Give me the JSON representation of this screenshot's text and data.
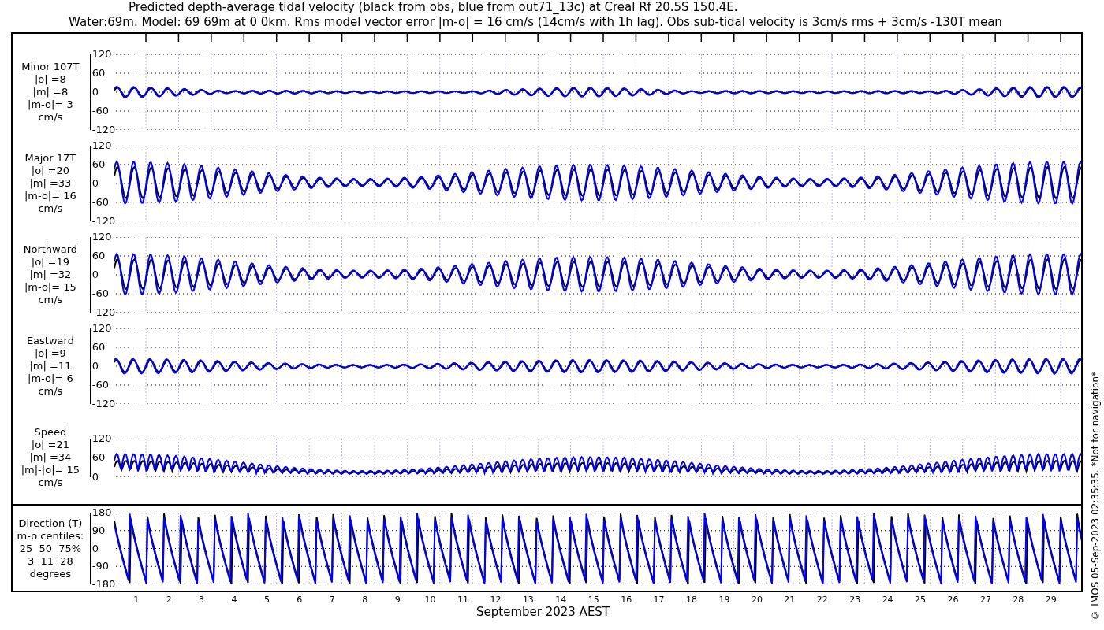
{
  "title_lines": [
    "Predicted depth-average tidal velocity (black from obs, blue from out71_13c) at Creal Rf 20.5S 150.4E.",
    "Water:69m. Model: 69 69m at 0 0km. Rms model vector error |m-o| = 16 cm/s (14cm/s with 1h lag). Obs sub-tidal velocity is 3cm/s rms + 3cm/s -130T mean"
  ],
  "panels": [
    {
      "kind": "minor",
      "label_lines": [
        "Minor 107T",
        "|o| =8",
        "|m| =8",
        "|m-o|= 3",
        "cm/s"
      ],
      "yticks": [
        "120",
        "60",
        "0",
        "-60",
        "-120"
      ]
    },
    {
      "kind": "major",
      "label_lines": [
        "Major 17T",
        "|o| =20",
        "|m| =33",
        "|m-o|= 16",
        "cm/s"
      ],
      "yticks": [
        "120",
        "60",
        "0",
        "-60",
        "-120"
      ]
    },
    {
      "kind": "north",
      "label_lines": [
        "Northward",
        "|o| =19",
        "|m| =32",
        "|m-o|= 15",
        "cm/s"
      ],
      "yticks": [
        "120",
        "60",
        "0",
        "-60",
        "-120"
      ]
    },
    {
      "kind": "east",
      "label_lines": [
        "Eastward",
        "|o| =9",
        "|m| =11",
        "|m-o|= 6",
        "cm/s"
      ],
      "yticks": [
        "120",
        "60",
        "0",
        "-60",
        "-120"
      ]
    },
    {
      "kind": "speed",
      "label_lines": [
        "Speed",
        "|o| =21",
        "|m| =34",
        "|m|-|o|= 15",
        "cm/s"
      ],
      "yticks": [
        "120",
        "60",
        "0"
      ]
    },
    {
      "kind": "direction",
      "label_lines": [
        "Direction (T)",
        "m-o centiles:",
        "25  50  75%",
        "3  11  28",
        "degrees"
      ],
      "yticks": [
        "180",
        "90",
        "0",
        "-90",
        "-180"
      ]
    }
  ],
  "day_labels": [
    "1",
    "2",
    "3",
    "4",
    "5",
    "6",
    "7",
    "8",
    "9",
    "10",
    "11",
    "12",
    "13",
    "14",
    "15",
    "16",
    "17",
    "18",
    "19",
    "20",
    "21",
    "22",
    "23",
    "24",
    "25",
    "26",
    "27",
    "28",
    "29"
  ],
  "xlabel": "September 2023 AEST",
  "credit": "© IMOS 05-Sep-2023 02:35:35. *Not for navigation*"
}
